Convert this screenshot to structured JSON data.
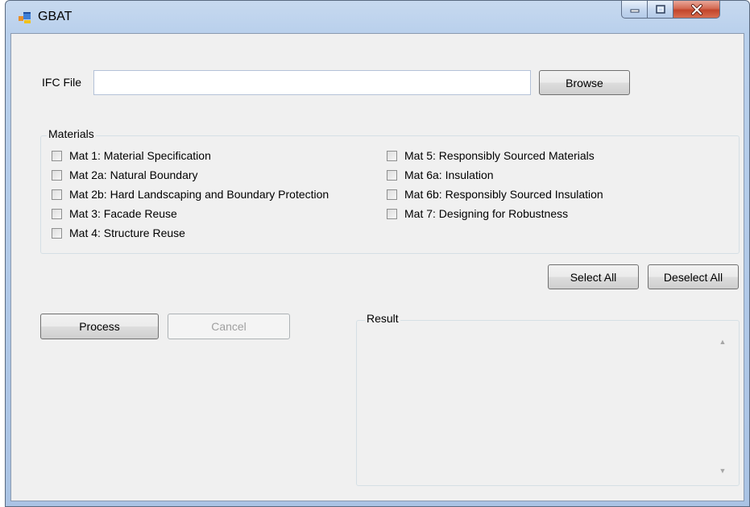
{
  "window": {
    "title": "GBAT",
    "minimize_glyph": "–",
    "maximize_glyph": "□",
    "close_glyph": "x"
  },
  "ifc": {
    "label": "IFC File",
    "value": "",
    "placeholder": "",
    "browse_label": "Browse"
  },
  "materials": {
    "group_label": "Materials",
    "left_items": [
      {
        "label": "Mat 1: Material Specification",
        "checked": false
      },
      {
        "label": "Mat 2a: Natural Boundary",
        "checked": false
      },
      {
        "label": "Mat 2b: Hard Landscaping and Boundary Protection",
        "checked": false
      },
      {
        "label": "Mat 3: Facade Reuse",
        "checked": false
      },
      {
        "label": "Mat 4: Structure Reuse",
        "checked": false
      }
    ],
    "right_items": [
      {
        "label": "Mat 5: Responsibly Sourced Materials",
        "checked": false
      },
      {
        "label": "Mat 6a: Insulation",
        "checked": false
      },
      {
        "label": "Mat 6b: Responsibly Sourced Insulation",
        "checked": false
      },
      {
        "label": "Mat 7: Designing for Robustness",
        "checked": false
      }
    ],
    "select_all_label": "Select All",
    "deselect_all_label": "Deselect All"
  },
  "actions": {
    "process_label": "Process",
    "cancel_label": "Cancel",
    "cancel_enabled": false
  },
  "result": {
    "group_label": "Result",
    "text": "",
    "scroll_up_glyph": "▲",
    "scroll_down_glyph": "▼"
  },
  "icons": {
    "app_icon": "windows-form-icon",
    "checkbox": "checkbox-unchecked"
  },
  "colors": {
    "title_bar": "#b9d0ec",
    "client_background": "#f0f0f0",
    "close_button": "#c2452b",
    "textbox_border": "#b4c2d8"
  }
}
